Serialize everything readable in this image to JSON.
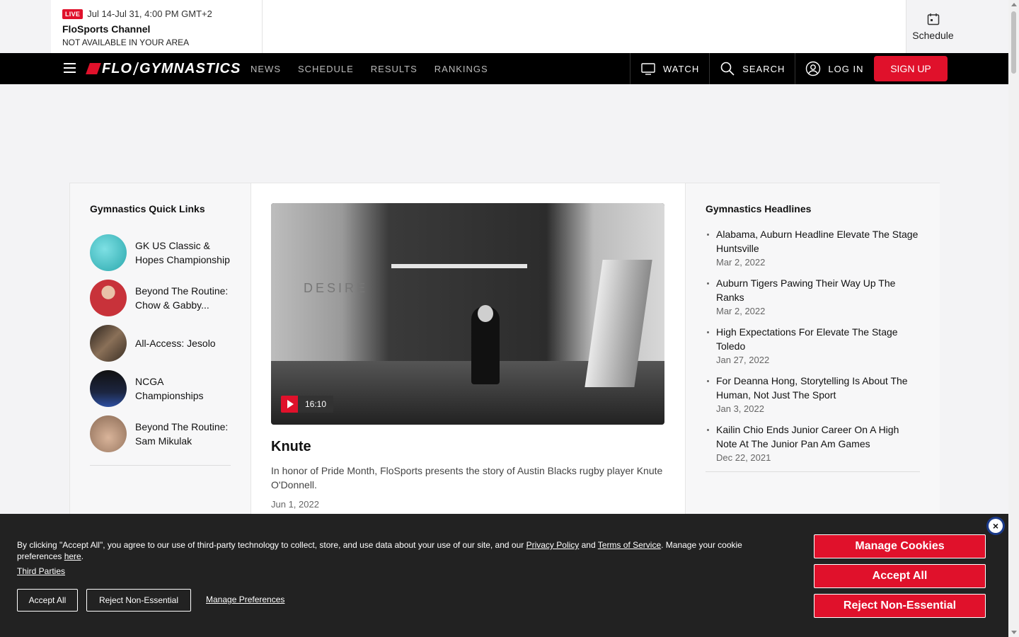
{
  "event": {
    "live_label": "LIVE",
    "date_range": "Jul 14-Jul 31, 4:00 PM GMT+2",
    "title": "FloSports Channel",
    "status": "NOT AVAILABLE IN YOUR AREA"
  },
  "schedule_label": "Schedule",
  "nav": {
    "logo_left": "FLO",
    "logo_right": "GYMNASTICS",
    "links": [
      "NEWS",
      "SCHEDULE",
      "RESULTS",
      "RANKINGS"
    ],
    "watch": "WATCH",
    "search": "SEARCH",
    "login": "LOG IN",
    "signup": "SIGN UP"
  },
  "quick_links": {
    "title": "Gymnastics Quick Links",
    "items": [
      {
        "label": "GK US Classic & Hopes Championship",
        "color": "#3fbfc4"
      },
      {
        "label": "Beyond The Routine: Chow & Gabby...",
        "color": "#c8323a"
      },
      {
        "label": "All-Access: Jesolo",
        "color": "#5a4a3a"
      },
      {
        "label": "NCGA Championships",
        "color": "#1c2540"
      },
      {
        "label": "Beyond The Routine: Sam Mikulak",
        "color": "#b89880"
      }
    ]
  },
  "feature": {
    "duration": "16:10",
    "title": "Knute",
    "description": "In honor of Pride Month, FloSports presents the story of Austin Blacks rugby player Knute O'Donnell.",
    "date": "Jun 1, 2022"
  },
  "headlines": {
    "title": "Gymnastics Headlines",
    "items": [
      {
        "title": "Alabama, Auburn Headline Elevate The Stage Huntsville",
        "date": "Mar 2, 2022"
      },
      {
        "title": "Auburn Tigers Pawing Their Way Up The Ranks",
        "date": "Mar 2, 2022"
      },
      {
        "title": "High Expectations For Elevate The Stage Toledo",
        "date": "Jan 27, 2022"
      },
      {
        "title": "For Deanna Hong, Storytelling Is About The Human, Not Just The Sport",
        "date": "Jan 3, 2022"
      },
      {
        "title": "Kailin Chio Ends Junior Career On A High Note At The Junior Pan Am Games",
        "date": "Dec 22, 2021"
      }
    ]
  },
  "cookie": {
    "text_1": "By clicking \"Accept All\", you agree to our use of third-party technology to collect, store, and use data about your use of our site, and our ",
    "privacy_link": "Privacy Policy",
    "text_2": " and ",
    "terms_link": "Terms of Service",
    "text_3": ". Manage your cookie preferences ",
    "here_link": "here",
    "text_4": ".",
    "third_parties": "Third Parties",
    "accept_all": "Accept All",
    "reject": "Reject Non-Essential",
    "manage_prefs": "Manage Preferences",
    "btn_manage_cookies": "Manage Cookies",
    "btn_accept_all": "Accept All",
    "btn_reject": "Reject Non-Essential",
    "close": "×"
  },
  "video_wall_text": "DESIRE",
  "colors": {
    "brand_red": "#e0112b",
    "nav_bg": "#000000",
    "cookie_bg": "#222222"
  }
}
